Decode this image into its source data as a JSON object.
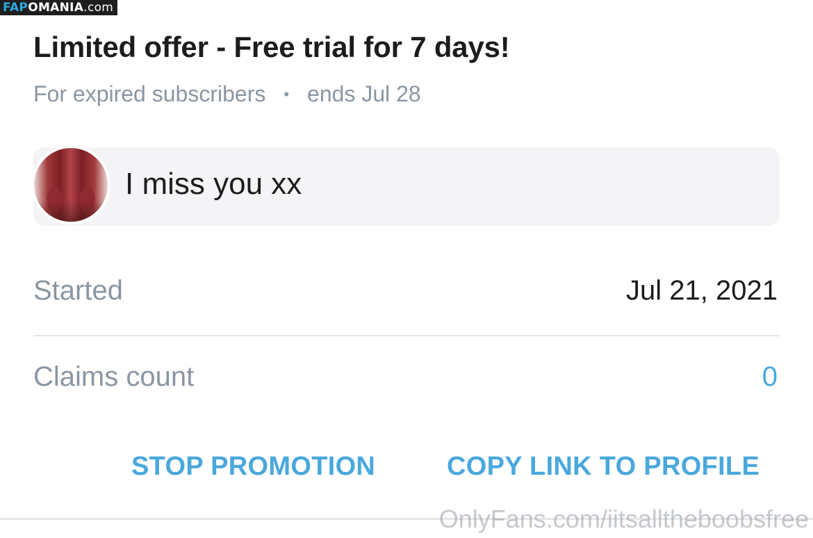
{
  "watermark_top": {
    "part1": "FAP",
    "part2": "OMANIA",
    "part3": ".com"
  },
  "offer": {
    "title": "Limited offer - Free trial for 7 days!",
    "audience": "For expired subscribers",
    "separator": "•",
    "ends": "ends Jul 28"
  },
  "message": {
    "text": "I miss you xx"
  },
  "details": {
    "started_label": "Started",
    "started_value": "Jul 21, 2021",
    "claims_label": "Claims count",
    "claims_value": "0"
  },
  "actions": {
    "stop_label": "STOP PROMOTION",
    "copy_label": "COPY LINK TO PROFILE"
  },
  "watermark_bottom": "OnlyFans.com/iitsalltheboobsfree",
  "colors": {
    "accent": "#4aa8dc",
    "muted": "#8a96a3",
    "text": "#1c1c1e",
    "card": "#f4f4f6"
  }
}
